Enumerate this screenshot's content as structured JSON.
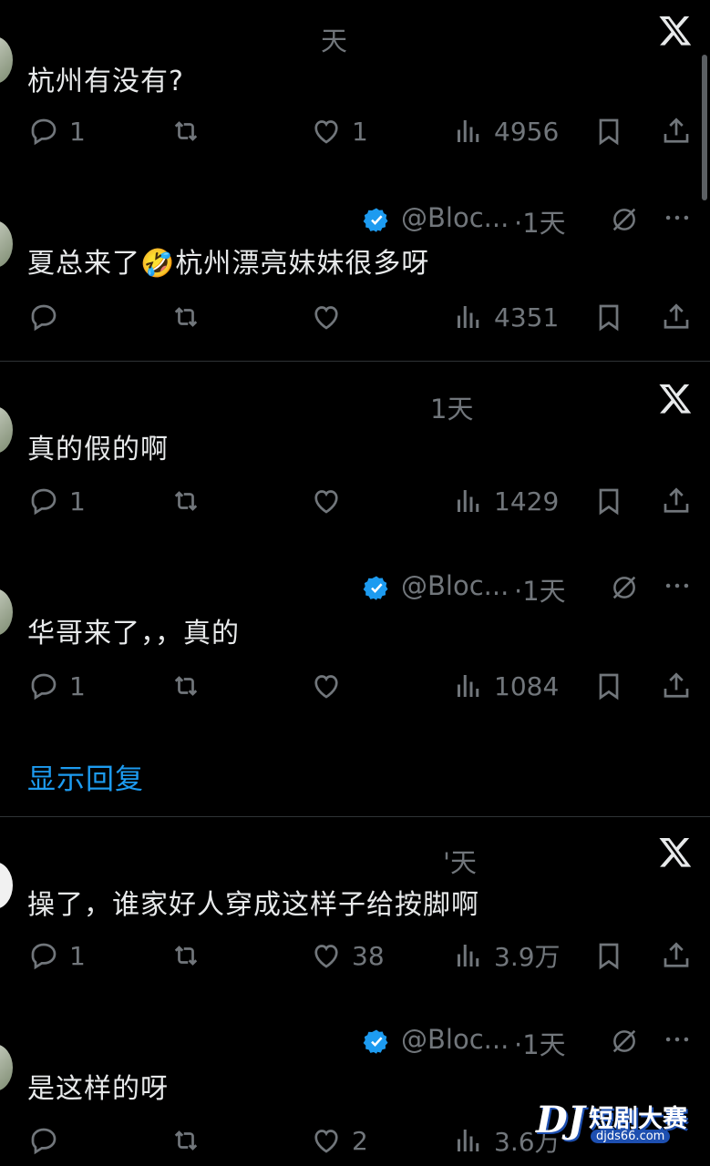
{
  "replies": [
    {
      "name": "",
      "handle": "",
      "time": "天",
      "text": "杭州有没有?",
      "stats": {
        "replies": "1",
        "retweets": "",
        "likes": "1",
        "views": "4956"
      }
    },
    {
      "name": "",
      "handle": "@Bloc...",
      "time": "·1天",
      "text": "夏总来了🤣杭州漂亮妹妹很多呀",
      "stats": {
        "replies": "",
        "retweets": "",
        "likes": "",
        "views": "4351"
      }
    },
    {
      "name": "",
      "handle": "",
      "time": "1天",
      "text": "真的假的啊",
      "stats": {
        "replies": "1",
        "retweets": "",
        "likes": "",
        "views": "1429"
      }
    },
    {
      "name": "",
      "handle": "@Bloc...",
      "time": "·1天",
      "text": "华哥来了，，真的",
      "stats": {
        "replies": "1",
        "retweets": "",
        "likes": "",
        "views": "1084"
      }
    },
    {
      "name": "",
      "handle": "",
      "time": "'天",
      "text": "操了，谁家好人穿成这样子给按脚啊",
      "stats": {
        "replies": "1",
        "retweets": "",
        "likes": "38",
        "views": "3.9万"
      }
    },
    {
      "name": "",
      "handle": "@Bloc...",
      "time": "·1天",
      "text": "是这样的呀",
      "stats": {
        "replies": "",
        "retweets": "",
        "likes": "2",
        "views": "3.6万"
      }
    }
  ],
  "show_replies_label": "显示回复",
  "watermark": {
    "logo": "DJ",
    "title": "短剧大赛",
    "site": "djds66.com"
  },
  "colors": {
    "background": "#000000",
    "text": "#e7e9ea",
    "muted": "#71767b",
    "accent": "#1d9bf0",
    "divider": "#2f3336"
  }
}
